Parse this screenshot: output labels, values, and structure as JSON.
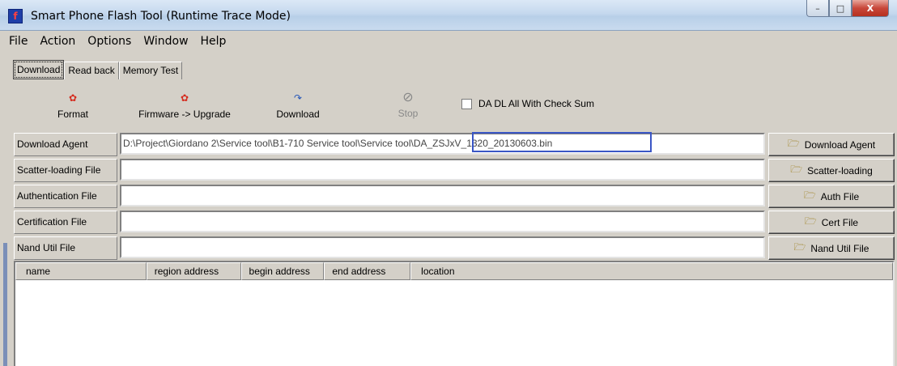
{
  "window": {
    "title": "Smart Phone Flash Tool (Runtime Trace Mode)",
    "app_icon_glyph": "f",
    "controls": [
      "–",
      "□",
      "X"
    ]
  },
  "menu": [
    "File",
    "Action",
    "Options",
    "Window",
    "Help"
  ],
  "tabs": [
    "Download",
    "Read back",
    "Memory Test"
  ],
  "toolbar": {
    "format": "Format",
    "firmware_upgrade": "Firmware -> Upgrade",
    "download": "Download",
    "stop": "Stop",
    "checksum_label": "DA DL All With Check Sum",
    "checksum_checked": false
  },
  "rows": {
    "download_agent": {
      "label": "Download Agent",
      "value": "D:\\Project\\Giordano 2\\Service tool\\B1-710 Service tool\\Service tool\\DA_ZSJxV_1320_20130603.bin",
      "button": "Download Agent"
    },
    "scatter": {
      "label": "Scatter-loading File",
      "value": "",
      "button": "Scatter-loading"
    },
    "auth": {
      "label": "Authentication File",
      "value": "",
      "button": "Auth File"
    },
    "cert": {
      "label": "Certification File",
      "value": "",
      "button": "Cert File"
    },
    "nand": {
      "label": "Nand Util File",
      "value": "",
      "button": "Nand Util File"
    }
  },
  "table": {
    "columns": [
      "name",
      "region address",
      "begin address",
      "end address",
      "location"
    ]
  },
  "colors": {
    "highlight_box": "#3a56c5"
  }
}
